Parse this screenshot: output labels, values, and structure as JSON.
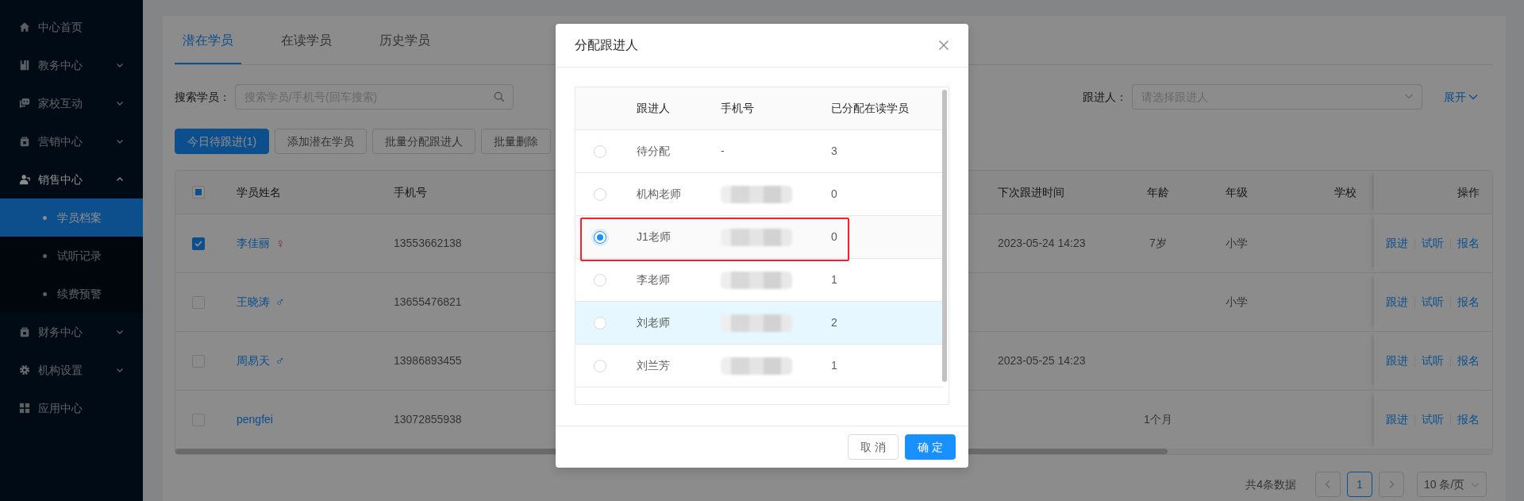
{
  "sidebar": {
    "items": [
      {
        "label": "中心首页"
      },
      {
        "label": "教务中心",
        "expanded": false
      },
      {
        "label": "家校互动",
        "expanded": false
      },
      {
        "label": "营销中心",
        "expanded": false
      },
      {
        "label": "销售中心",
        "expanded": true,
        "children": [
          {
            "label": "学员档案",
            "selected": true
          },
          {
            "label": "试听记录",
            "selected": false
          },
          {
            "label": "续费预警",
            "selected": false
          }
        ]
      },
      {
        "label": "财务中心",
        "expanded": false
      },
      {
        "label": "机构设置",
        "expanded": false
      },
      {
        "label": "应用中心"
      }
    ]
  },
  "tabs": [
    {
      "label": "潜在学员",
      "selected": true
    },
    {
      "label": "在读学员",
      "selected": false
    },
    {
      "label": "历史学员",
      "selected": false
    }
  ],
  "filters": {
    "search_label": "搜索学员：",
    "search_placeholder": "搜索学员/手机号(回车搜索)",
    "follower_label": "跟进人：",
    "follower_placeholder": "请选择跟进人",
    "expand_link": "展开"
  },
  "toolbar": [
    {
      "label": "今日待跟进(1)",
      "primary": true
    },
    {
      "label": "添加潜在学员",
      "primary": false
    },
    {
      "label": "批量分配跟进人",
      "primary": false
    },
    {
      "label": "批量删除",
      "primary": false
    }
  ],
  "table": {
    "header_checkbox": {
      "indeterminate": true
    },
    "columns": [
      "学员姓名",
      "手机号",
      "下次跟进时间",
      "年龄",
      "年级",
      "学校",
      "操作"
    ],
    "rows": [
      {
        "checked": true,
        "name": "李佳丽",
        "gender": "♀",
        "kind": "female",
        "phone": "13553662138",
        "next_follow": "2023-05-24 14:23",
        "age": "7岁",
        "grade": "小学",
        "actions": [
          "跟进",
          "试听",
          "报名"
        ]
      },
      {
        "checked": false,
        "name": "王晓涛",
        "gender": "♂",
        "kind": "male",
        "phone": "13655476821",
        "grade": "小学",
        "actions": [
          "跟进",
          "试听",
          "报名"
        ]
      },
      {
        "checked": false,
        "name": "周易天",
        "gender": "♂",
        "kind": "male",
        "phone": "13986893455",
        "next_follow": "2023-05-25 14:23",
        "actions": [
          "跟进",
          "试听",
          "报名"
        ]
      },
      {
        "checked": false,
        "name": "pengfei",
        "phone": "13072855938",
        "age": "1个月",
        "actions": [
          "跟进",
          "试听",
          "报名"
        ]
      }
    ]
  },
  "pagination": {
    "total": "共4条数据",
    "pages": [
      {
        "label": "1",
        "selected": true
      }
    ],
    "page_size": "10 条/页"
  },
  "dialog": {
    "title": "分配跟进人",
    "columns": [
      "跟进人",
      "手机号",
      "已分配在读学员"
    ],
    "rows": [
      {
        "name": "待分配",
        "phone": "-",
        "count": "3",
        "selected": false,
        "highlighted": false,
        "hovered": false
      },
      {
        "name": "机构老师",
        "phone_redacted": true,
        "count": "0",
        "selected": false,
        "highlighted": false,
        "hovered": false
      },
      {
        "name": "J1老师",
        "phone_redacted": true,
        "count": "0",
        "selected": true,
        "highlighted": true,
        "hovered": false
      },
      {
        "name": "李老师",
        "phone_redacted": true,
        "count": "1",
        "selected": false,
        "highlighted": false,
        "hovered": false
      },
      {
        "name": "刘老师",
        "phone_redacted": true,
        "count": "2",
        "selected": false,
        "highlighted": false,
        "hovered": true
      },
      {
        "name": "刘兰芳",
        "phone_redacted": true,
        "count": "1",
        "selected": false,
        "highlighted": false,
        "hovered": false
      }
    ],
    "buttons": [
      {
        "label": "取 消",
        "primary": false
      },
      {
        "label": "确 定",
        "primary": true
      }
    ]
  }
}
